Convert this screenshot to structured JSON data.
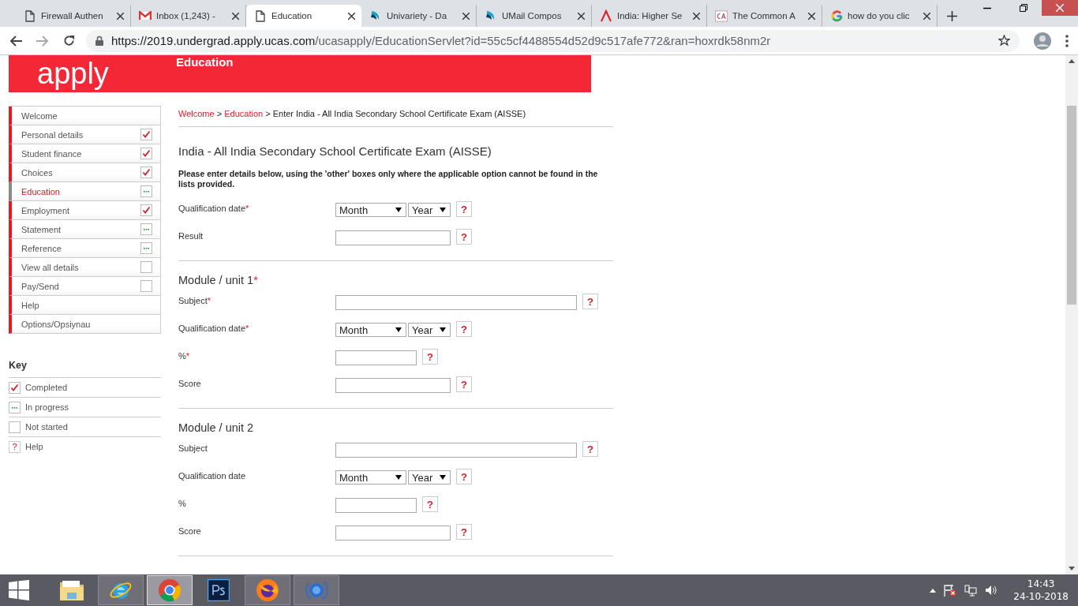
{
  "browser": {
    "tabs": [
      {
        "title": "Firewall Authen",
        "kind": "page",
        "selected": false
      },
      {
        "title": "Inbox (1,243) -",
        "kind": "mail",
        "selected": false
      },
      {
        "title": "Education",
        "kind": "page",
        "selected": true
      },
      {
        "title": "Univariety - Da",
        "kind": "swoosh",
        "selected": false
      },
      {
        "title": "UMail Compos",
        "kind": "swoosh",
        "selected": false
      },
      {
        "title": "India: Higher Se",
        "kind": "caret",
        "selected": false
      },
      {
        "title": "The Common A",
        "kind": "ca",
        "selected": false
      },
      {
        "title": "how do you clic",
        "kind": "g",
        "selected": false
      }
    ],
    "url_host": "https://2019.undergrad.apply.ucas.com",
    "url_path": "/ucasapply/EducationServlet?id=55c5cf4488554d52d9c517afe772&ran=hoxrdk58nm2r"
  },
  "banner": {
    "logo": "apply",
    "section": "Education"
  },
  "sidebar": {
    "items": [
      {
        "label": "Welcome",
        "kind": "plain",
        "selected": false
      },
      {
        "label": "Personal details",
        "kind": "completed",
        "selected": false
      },
      {
        "label": "Student finance",
        "kind": "completed",
        "selected": false
      },
      {
        "label": "Choices",
        "kind": "completed",
        "selected": false
      },
      {
        "label": "Education",
        "kind": "in_progress",
        "selected": true
      },
      {
        "label": "Employment",
        "kind": "completed",
        "selected": false
      },
      {
        "label": "Statement",
        "kind": "in_progress",
        "selected": false
      },
      {
        "label": "Reference",
        "kind": "in_progress",
        "selected": false
      },
      {
        "label": "View all details",
        "kind": "not_started",
        "selected": false
      },
      {
        "label": "Pay/Send",
        "kind": "not_started",
        "selected": false
      },
      {
        "label": "Help",
        "kind": "plain",
        "selected": false
      },
      {
        "label": "Options/Opsiynau",
        "kind": "plain",
        "selected": false
      }
    ],
    "key_title": "Key",
    "key": [
      {
        "label": "Completed",
        "kind": "completed"
      },
      {
        "label": "In progress",
        "kind": "in_progress"
      },
      {
        "label": "Not started",
        "kind": "not_started"
      },
      {
        "label": "Help",
        "kind": "help",
        "mark": "?"
      }
    ]
  },
  "breadcrumb": [
    {
      "label": "Welcome",
      "kind": "link"
    },
    {
      "label": ">",
      "kind": "text"
    },
    {
      "label": "Education",
      "kind": "link"
    },
    {
      "label": ">",
      "kind": "text"
    },
    {
      "label": "Enter India - All India Secondary School Certificate Exam (AISSE)",
      "kind": "text"
    }
  ],
  "heading": "India - All India Secondary School Certificate Exam (AISSE)",
  "instructions": "Please enter details below, using the 'other' boxes only where the applicable option cannot be found in the lists provided.",
  "sections": [
    {
      "fields": [
        {
          "label": "Qualification date",
          "required_mark": "*",
          "kind": "date",
          "month": "Month",
          "year": "Year",
          "help": "?"
        },
        {
          "label": "Result",
          "kind": "medium_text",
          "help": "?"
        }
      ]
    },
    {
      "title": "Module / unit 1",
      "required_mark": "*",
      "fields": [
        {
          "label": "Subject",
          "required_mark": "*",
          "kind": "long_text",
          "help": "?"
        },
        {
          "label": "Qualification date",
          "required_mark": "*",
          "kind": "date",
          "month": "Month",
          "year": "Year",
          "help": "?"
        },
        {
          "label": "%",
          "required_mark": "*",
          "kind": "short_text",
          "help": "?"
        },
        {
          "label": "Score",
          "kind": "medium_text",
          "help": "?"
        }
      ]
    },
    {
      "title": "Module / unit 2",
      "fields": [
        {
          "label": "Subject",
          "kind": "long_text",
          "help": "?"
        },
        {
          "label": "Qualification date",
          "kind": "date",
          "month": "Month",
          "year": "Year",
          "help": "?"
        },
        {
          "label": "%",
          "kind": "short_text",
          "help": "?"
        },
        {
          "label": "Score",
          "kind": "medium_text",
          "help": "?"
        }
      ]
    }
  ],
  "taskbar": {
    "apps": [
      {
        "kind": "folder",
        "open": false,
        "selected": false
      },
      {
        "kind": "ie",
        "open": true,
        "selected": false
      },
      {
        "kind": "chrome",
        "open": true,
        "selected": true
      },
      {
        "kind": "ps",
        "open": false,
        "selected": false
      },
      {
        "kind": "firefox",
        "open": true,
        "selected": false
      },
      {
        "kind": "globe",
        "open": true,
        "selected": false
      }
    ],
    "time": "14:43",
    "date": "24-10-2018"
  }
}
